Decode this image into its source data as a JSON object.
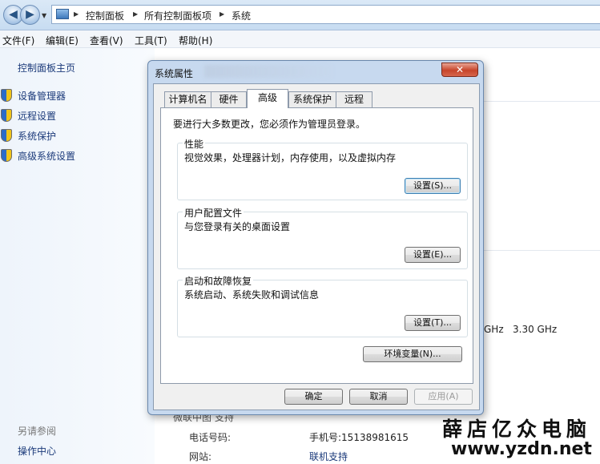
{
  "address_bar": {
    "breadcrumbs": [
      "控制面板",
      "所有控制面板项",
      "系统"
    ]
  },
  "menu": {
    "items": [
      "文件(F)",
      "编辑(E)",
      "查看(V)",
      "工具(T)",
      "帮助(H)"
    ]
  },
  "left_pane": {
    "home": "控制面板主页",
    "links": [
      "设备管理器",
      "远程设置",
      "系统保护",
      "高级系统设置"
    ],
    "see_also": "另请参阅",
    "action_center": "操作中心"
  },
  "background": {
    "cpu_partial": "GHz",
    "cpu_speed": "3.30 GHz",
    "support_header_partial": "微联中图 支持",
    "phone_label": "电话号码:",
    "phone_value": "手机号:15138981615",
    "website_label": "网站:",
    "website_value": "联机支持"
  },
  "dialog": {
    "title": "系统属性",
    "close_label": "✕",
    "tabs": [
      {
        "label": "计算机名",
        "active": false
      },
      {
        "label": "硬件",
        "active": false
      },
      {
        "label": "高级",
        "active": true
      },
      {
        "label": "系统保护",
        "active": false
      },
      {
        "label": "远程",
        "active": false
      }
    ],
    "intro": "要进行大多数更改，您必须作为管理员登录。",
    "groups": [
      {
        "title": "性能",
        "desc": "视觉效果，处理器计划，内存使用，以及虚拟内存",
        "button": "设置(S)..."
      },
      {
        "title": "用户配置文件",
        "desc": "与您登录有关的桌面设置",
        "button": "设置(E)..."
      },
      {
        "title": "启动和故障恢复",
        "desc": "系统启动、系统失败和调试信息",
        "button": "设置(T)..."
      }
    ],
    "env_button": "环境变量(N)...",
    "ok": "确定",
    "cancel": "取消",
    "apply": "应用(A)"
  },
  "watermark": {
    "brand": "薛店亿众电脑",
    "url": "www.yzdn.net"
  },
  "colors": {
    "link": "#1b3a7a",
    "dialog_frame": "#c7d9ef",
    "close_red": "#c7452b"
  }
}
